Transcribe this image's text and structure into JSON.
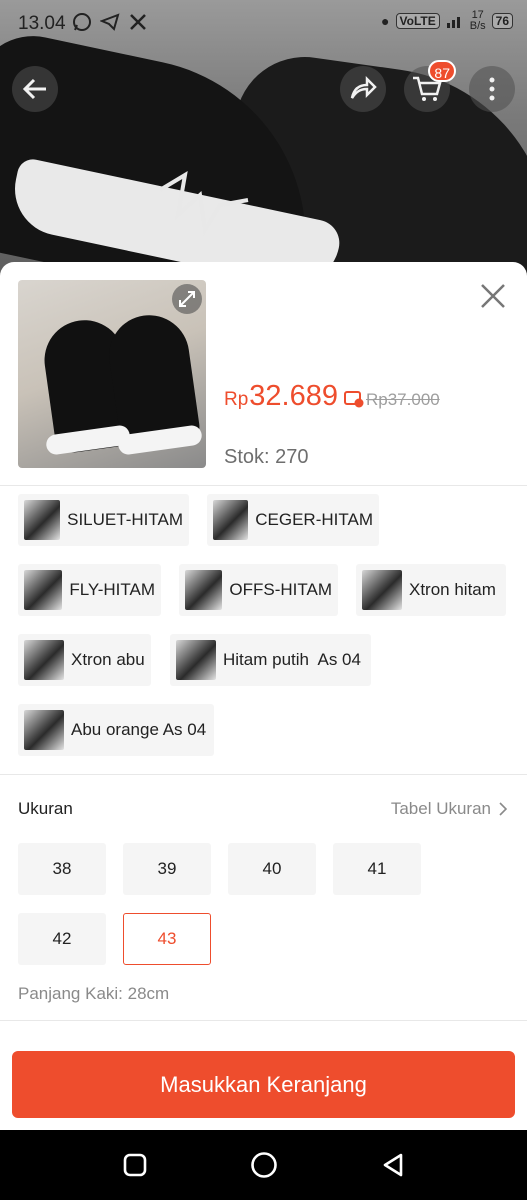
{
  "status_bar": {
    "time": "13.04",
    "network_label": "VoLTE",
    "net_speed_value": "17",
    "net_speed_unit": "B/s",
    "battery": "76"
  },
  "header": {
    "cart_count": "87"
  },
  "product": {
    "currency": "Rp",
    "price": "32.689",
    "original_price": "Rp37.000",
    "stock_text": "Stok: 270"
  },
  "variants": [
    {
      "label": "SILUET-HITAM"
    },
    {
      "label": "CEGER-HITAM"
    },
    {
      "label": "FLY-HITAM"
    },
    {
      "label": "OFFS-HITAM"
    },
    {
      "label": "Xtron hitam"
    },
    {
      "label": "Xtron abu"
    },
    {
      "label": "Hitam putih  As 04"
    },
    {
      "label": "Abu orange As 04"
    }
  ],
  "size_section": {
    "title": "Ukuran",
    "size_chart_link": "Tabel Ukuran",
    "sizes": [
      "38",
      "39",
      "40",
      "41",
      "42",
      "43"
    ],
    "selected_size": "43",
    "foot_length": "Panjang Kaki: 28cm"
  },
  "actions": {
    "add_to_cart": "Masukkan Keranjang"
  },
  "colors": {
    "accent": "#ee4d2d",
    "chip_bg": "#f5f5f5"
  }
}
